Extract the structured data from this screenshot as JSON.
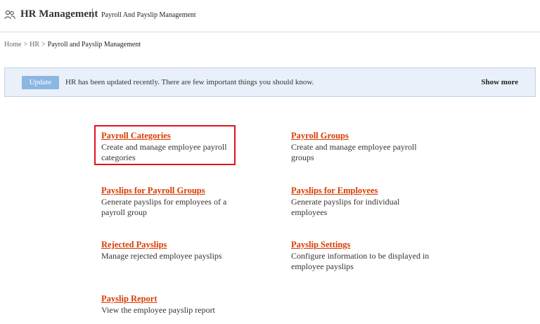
{
  "header": {
    "title": "HR Management",
    "separator": "|",
    "subtitle": "Payroll And Payslip Management",
    "icon": "users-icon"
  },
  "breadcrumb": {
    "items": [
      "Home",
      "HR",
      "Payroll and Payslip Management"
    ],
    "separator": ">"
  },
  "notice": {
    "button_label": "Update",
    "message": "HR has been updated recently. There are few important things you should know.",
    "show_more_label": "Show more"
  },
  "items": [
    {
      "title": "Payroll Categories",
      "description": "Create and manage employee payroll categories",
      "selected": true
    },
    {
      "title": "Payroll Groups",
      "description": "Create and manage employee payroll groups"
    },
    {
      "title": "Payslips for Payroll Groups",
      "description": "Generate payslips for employees of a payroll group"
    },
    {
      "title": "Payslips for Employees",
      "description": "Generate payslips for individual employees"
    },
    {
      "title": "Rejected Payslips",
      "description": "Manage rejected employee payslips"
    },
    {
      "title": "Payslip Settings",
      "description": "Configure information to be displayed in employee payslips"
    },
    {
      "title": "Payslip Report",
      "description": "View the employee payslip report"
    }
  ],
  "colors": {
    "link": "#d83b01",
    "highlight_border": "#e0141e",
    "notice_bg": "#e9f0f9",
    "update_button": "#8cb6e2"
  }
}
